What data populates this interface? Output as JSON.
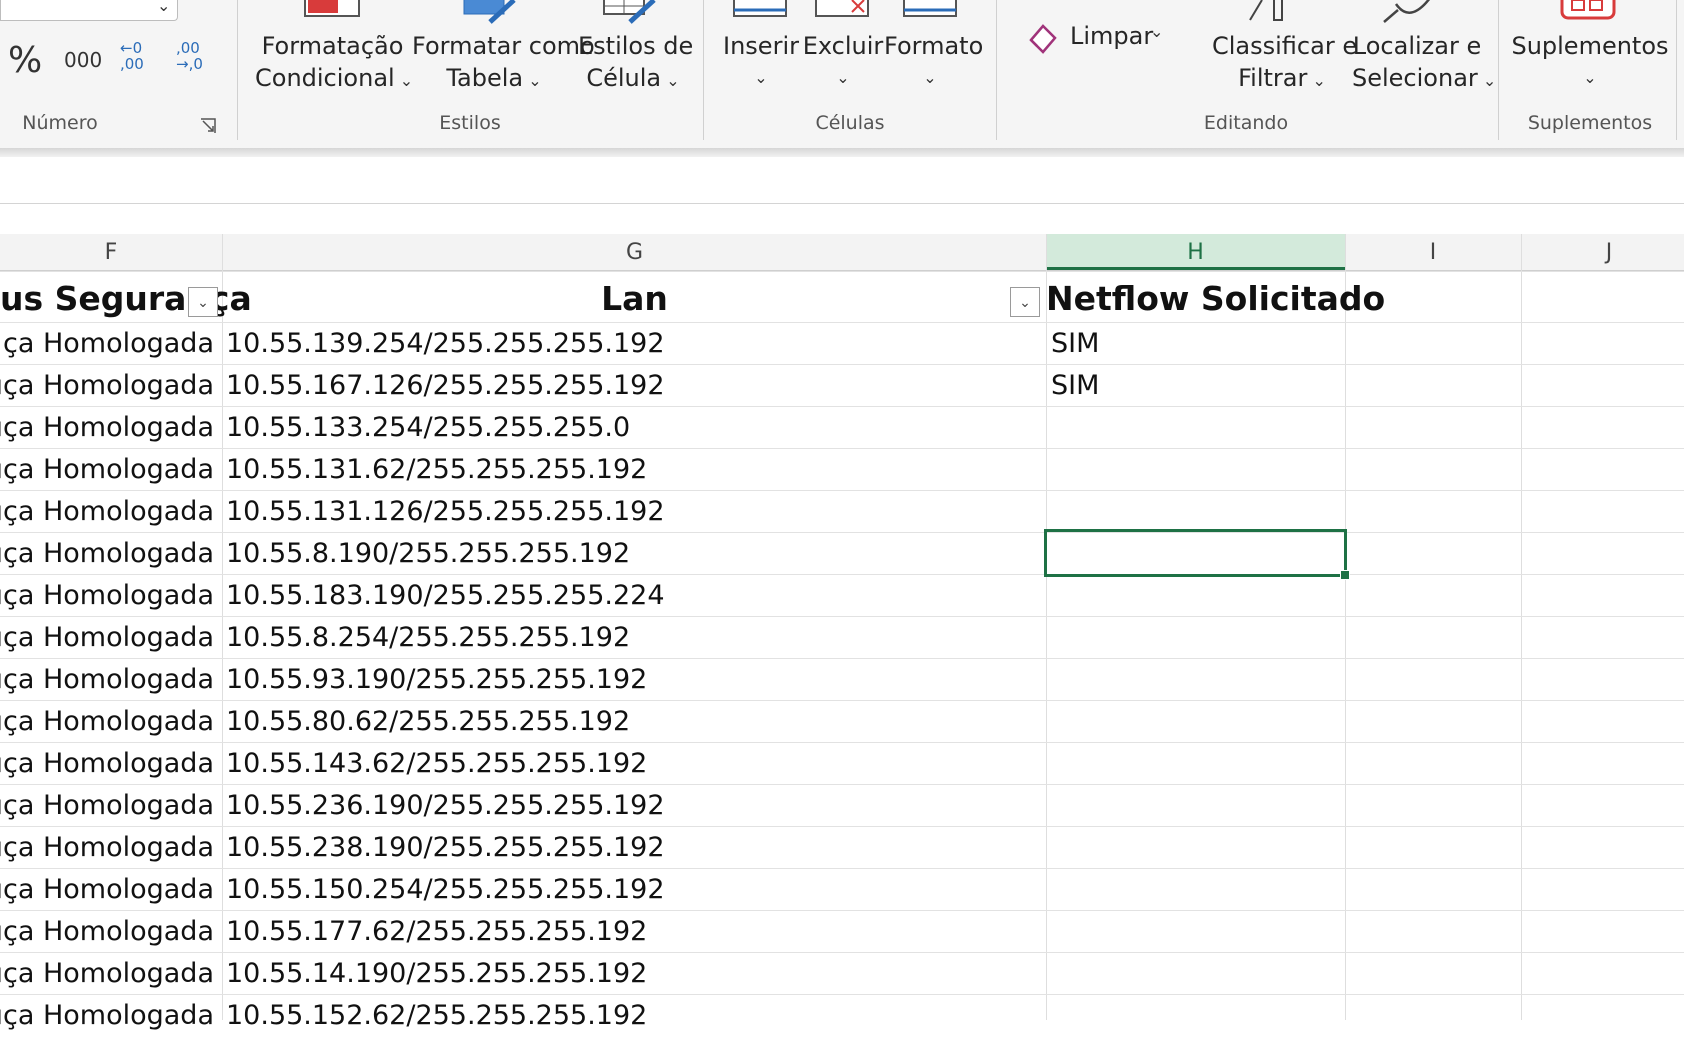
{
  "ribbon": {
    "numero": {
      "percent_symbol": "%",
      "thousands_symbol": "000",
      "decrease_decimal_symbol": "←0 ,00",
      "increase_decimal_symbol": ",00 →,0",
      "group_label": "Número"
    },
    "estilos": {
      "conditional_formatting": [
        "Formatação",
        "Condicional"
      ],
      "format_as_table": [
        "Formatar como",
        "Tabela"
      ],
      "cell_styles": [
        "Estilos de",
        "Célula"
      ],
      "group_label": "Estilos"
    },
    "celulas": {
      "insert": "Inserir",
      "delete": "Excluir",
      "format": "Formato",
      "group_label": "Células"
    },
    "editando": {
      "clear": "Limpar",
      "sort_filter": [
        "Classificar e",
        "Filtrar"
      ],
      "find_select": [
        "Localizar e",
        "Selecionar"
      ],
      "group_label": "Editando"
    },
    "suplementos": {
      "addins": "Suplementos",
      "group_label": "Suplementos"
    }
  },
  "sheet": {
    "columns": [
      "F",
      "G",
      "H",
      "I",
      "J"
    ],
    "selected_column": "H",
    "headers": {
      "f": "us Segurança",
      "g": "Lan",
      "h": "Netflow Solicitado"
    },
    "rows": [
      {
        "f": "ça Homologada",
        "g": "10.55.139.254/255.255.255.192",
        "h": "SIM"
      },
      {
        "f": "ıça Homologada",
        "g": "10.55.167.126/255.255.255.192",
        "h": "SIM"
      },
      {
        "f": "ıça Homologada",
        "g": "10.55.133.254/255.255.255.0",
        "h": ""
      },
      {
        "f": "ıça Homologada",
        "g": "10.55.131.62/255.255.255.192",
        "h": ""
      },
      {
        "f": "ıça Homologada",
        "g": " 10.55.131.126/255.255.255.192",
        "h": ""
      },
      {
        "f": "ıça Homologada",
        "g": "10.55.8.190/255.255.255.192",
        "h": ""
      },
      {
        "f": "ıça Homologada",
        "g": "10.55.183.190/255.255.255.224",
        "h": ""
      },
      {
        "f": "ıça Homologada",
        "g": "10.55.8.254/255.255.255.192",
        "h": ""
      },
      {
        "f": "ıça Homologada",
        "g": "10.55.93.190/255.255.255.192",
        "h": ""
      },
      {
        "f": "ıça Homologada",
        "g": "10.55.80.62/255.255.255.192",
        "h": ""
      },
      {
        "f": "ıça Homologada",
        "g": "10.55.143.62/255.255.255.192",
        "h": ""
      },
      {
        "f": "ıça Homologada",
        "g": "10.55.236.190/255.255.255.192",
        "h": ""
      },
      {
        "f": "ıça Homologada",
        "g": "10.55.238.190/255.255.255.192",
        "h": ""
      },
      {
        "f": "ıça Homologada",
        "g": "10.55.150.254/255.255.255.192",
        "h": ""
      },
      {
        "f": "ıça Homologada",
        "g": "10.55.177.62/255.255.255.192",
        "h": ""
      },
      {
        "f": "ıça Homologada",
        "g": "10.55.14.190/255.255.255.192",
        "h": ""
      },
      {
        "f": "ıça Homologada",
        "g": "10.55.152.62/255.255.255.192",
        "h": ""
      }
    ]
  },
  "colors": {
    "accent_green": "#1e7145",
    "selected_header_bg": "#d3eadb",
    "ribbon_red": "#d83b3b",
    "ribbon_blue": "#2b6cb8"
  }
}
